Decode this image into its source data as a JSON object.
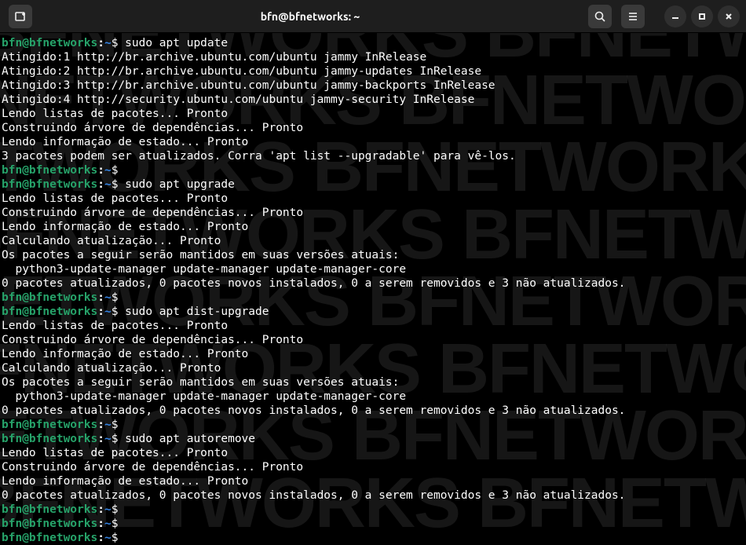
{
  "titlebar": {
    "title": "bfn@bfnetworks: ~"
  },
  "prompt": {
    "user": "bfn@bfnetworks",
    "colon": ":",
    "path": "~",
    "dollar": "$"
  },
  "lines": [
    {
      "type": "prompt",
      "cmd": "sudo apt update"
    },
    {
      "type": "out",
      "text": "Atingido:1 http://br.archive.ubuntu.com/ubuntu jammy InRelease"
    },
    {
      "type": "out",
      "text": "Atingido:2 http://br.archive.ubuntu.com/ubuntu jammy-updates InRelease"
    },
    {
      "type": "out",
      "text": "Atingido:3 http://br.archive.ubuntu.com/ubuntu jammy-backports InRelease"
    },
    {
      "type": "out",
      "text": "Atingido:4 http://security.ubuntu.com/ubuntu jammy-security InRelease"
    },
    {
      "type": "out",
      "text": "Lendo listas de pacotes... Pronto"
    },
    {
      "type": "out",
      "text": "Construindo árvore de dependências... Pronto"
    },
    {
      "type": "out",
      "text": "Lendo informação de estado... Pronto"
    },
    {
      "type": "out",
      "text": "3 pacotes podem ser atualizados. Corra 'apt list --upgradable' para vê-los."
    },
    {
      "type": "prompt",
      "cmd": ""
    },
    {
      "type": "prompt",
      "cmd": "sudo apt upgrade"
    },
    {
      "type": "out",
      "text": "Lendo listas de pacotes... Pronto"
    },
    {
      "type": "out",
      "text": "Construindo árvore de dependências... Pronto"
    },
    {
      "type": "out",
      "text": "Lendo informação de estado... Pronto"
    },
    {
      "type": "out",
      "text": "Calculando atualização... Pronto"
    },
    {
      "type": "out",
      "text": "Os pacotes a seguir serão mantidos em suas versões atuais:"
    },
    {
      "type": "out",
      "text": "  python3-update-manager update-manager update-manager-core"
    },
    {
      "type": "out",
      "text": "0 pacotes atualizados, 0 pacotes novos instalados, 0 a serem removidos e 3 não atualizados."
    },
    {
      "type": "prompt",
      "cmd": ""
    },
    {
      "type": "prompt",
      "cmd": "sudo apt dist-upgrade"
    },
    {
      "type": "out",
      "text": "Lendo listas de pacotes... Pronto"
    },
    {
      "type": "out",
      "text": "Construindo árvore de dependências... Pronto"
    },
    {
      "type": "out",
      "text": "Lendo informação de estado... Pronto"
    },
    {
      "type": "out",
      "text": "Calculando atualização... Pronto"
    },
    {
      "type": "out",
      "text": "Os pacotes a seguir serão mantidos em suas versões atuais:"
    },
    {
      "type": "out",
      "text": "  python3-update-manager update-manager update-manager-core"
    },
    {
      "type": "out",
      "text": "0 pacotes atualizados, 0 pacotes novos instalados, 0 a serem removidos e 3 não atualizados."
    },
    {
      "type": "prompt",
      "cmd": ""
    },
    {
      "type": "prompt",
      "cmd": "sudo apt autoremove"
    },
    {
      "type": "out",
      "text": "Lendo listas de pacotes... Pronto"
    },
    {
      "type": "out",
      "text": "Construindo árvore de dependências... Pronto"
    },
    {
      "type": "out",
      "text": "Lendo informação de estado... Pronto"
    },
    {
      "type": "out",
      "text": "0 pacotes atualizados, 0 pacotes novos instalados, 0 a serem removidos e 3 não atualizados."
    },
    {
      "type": "prompt",
      "cmd": ""
    },
    {
      "type": "prompt",
      "cmd": ""
    },
    {
      "type": "prompt",
      "cmd": ""
    }
  ],
  "watermark": "BFNETWORKS"
}
